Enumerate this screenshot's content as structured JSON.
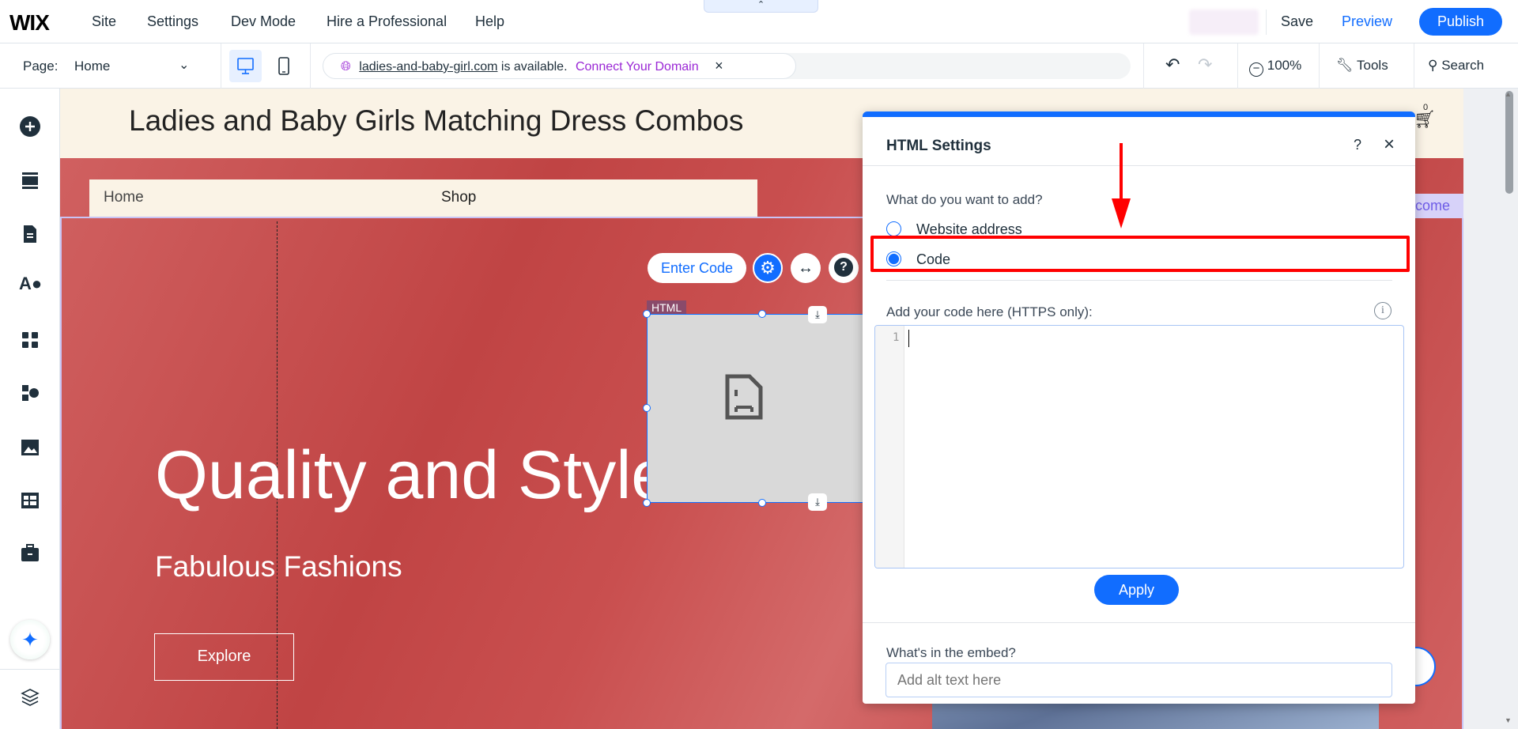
{
  "topbar": {
    "logo": "WIX",
    "menu": [
      "Site",
      "Settings",
      "Dev Mode",
      "Hire a Professional",
      "Help"
    ],
    "save": "Save",
    "preview": "Preview",
    "publish": "Publish",
    "collapse_icon": "chevron-up-icon"
  },
  "toolbar": {
    "page_label": "Page:",
    "page_value": "Home",
    "domain": "ladies-and-baby-girl.com",
    "domain_status": "is available.",
    "connect": "Connect Your Domain",
    "close": "×",
    "zoom": "100%",
    "tools": "Tools",
    "search": "Search"
  },
  "site": {
    "title": "Ladies and Baby Girls Matching Dress Combos",
    "nav": [
      "Home",
      "Shop"
    ],
    "hero_title": "Quality and Style",
    "hero_subtitle": "Fabulous Fashions",
    "explore": "Explore",
    "welcome_partial": "come",
    "cart_count": "0"
  },
  "html_element": {
    "label": "HTML",
    "enter_code": "Enter Code"
  },
  "dialog": {
    "title": "HTML Settings",
    "help": "?",
    "close": "×",
    "question": "What do you want to add?",
    "options": [
      {
        "label": "Website address",
        "selected": false
      },
      {
        "label": "Code",
        "selected": true
      }
    ],
    "code_label": "Add your code here (HTTPS only):",
    "line_number": "1",
    "code_value": "",
    "apply": "Apply",
    "embed_label": "What's in the embed?",
    "alt_placeholder": "Add alt text here"
  },
  "colors": {
    "accent": "#116dff",
    "highlight": "#ff0000",
    "hero": "#c84a4a",
    "cream": "#faf3e6"
  }
}
